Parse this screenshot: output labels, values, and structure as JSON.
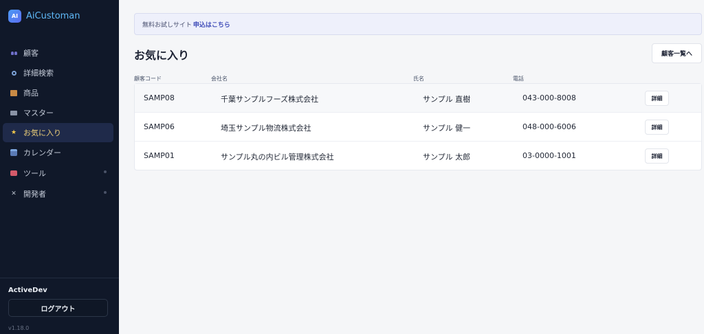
{
  "brand": {
    "logo_text": "AI",
    "name": "AiCustoman"
  },
  "sidebar": {
    "items": [
      {
        "label": "顧客",
        "icon": "users-icon"
      },
      {
        "label": "詳細検索",
        "icon": "search-icon"
      },
      {
        "label": "商品",
        "icon": "box-icon"
      },
      {
        "label": "マスター",
        "icon": "folder-icon"
      },
      {
        "label": "お気に入り",
        "icon": "star-icon",
        "active": true
      },
      {
        "label": "カレンダー",
        "icon": "calendar-icon"
      },
      {
        "label": "ツール",
        "icon": "toolbox-icon",
        "expandable": true
      },
      {
        "label": "開発者",
        "icon": "tools-icon",
        "expandable": true
      }
    ],
    "user": "ActiveDev",
    "logout_label": "ログアウト",
    "version": "v1.18.0"
  },
  "banner": {
    "text": "無料お試しサイト",
    "link": "申込はこちら"
  },
  "page": {
    "title": "お気に入り",
    "customer_list_button": "顧客一覧へ"
  },
  "table": {
    "headers": [
      "顧客コード",
      "会社名",
      "氏名",
      "電話"
    ],
    "detail_label": "詳細",
    "rows": [
      {
        "code": "SAMP08",
        "company": "千葉サンプルフーズ株式会社",
        "name": "サンプル 直樹",
        "phone": "043-000-8008"
      },
      {
        "code": "SAMP06",
        "company": "埼玉サンプル物流株式会社",
        "name": "サンプル 健一",
        "phone": "048-000-6006"
      },
      {
        "code": "SAMP01",
        "company": "サンプル丸の内ビル管理株式会社",
        "name": "サンプル 太郎",
        "phone": "03-0000-1001"
      }
    ]
  },
  "colors": {
    "sidebar_bg": "#101829",
    "active_bg": "#1f2a4a",
    "active_text": "#f1d27a",
    "brand_text": "#5fb8f7",
    "link": "#3e4bb8"
  }
}
